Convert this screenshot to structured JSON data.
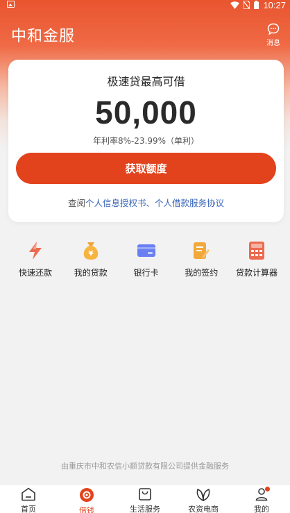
{
  "status_bar": {
    "time": "10:27"
  },
  "header": {
    "title": "中和金服",
    "message_label": "消息"
  },
  "loan_card": {
    "heading": "极速贷最高可借",
    "amount": "50,000",
    "rate": "年利率8%-23.99%（单利）",
    "button_label": "获取额度",
    "agreement_prefix": "查阅",
    "agreement_link": "个人信息授权书、个人借款服务协议"
  },
  "quick_actions": [
    {
      "label": "快速还款",
      "icon": "lightning-icon"
    },
    {
      "label": "我的贷款",
      "icon": "money-bag-icon"
    },
    {
      "label": "银行卡",
      "icon": "bank-card-icon"
    },
    {
      "label": "我的签约",
      "icon": "contract-icon"
    },
    {
      "label": "贷款计算器",
      "icon": "calculator-icon"
    }
  ],
  "footer_note": "由重庆市中和农信小额贷款有限公司提供金融服务",
  "tabbar": [
    {
      "label": "首页",
      "icon": "home-icon",
      "active": false
    },
    {
      "label": "借钱",
      "icon": "borrow-icon",
      "active": true
    },
    {
      "label": "生活服务",
      "icon": "shopping-bag-icon",
      "active": false
    },
    {
      "label": "农资电商",
      "icon": "leaf-icon",
      "active": false
    },
    {
      "label": "我的",
      "icon": "user-icon",
      "active": false
    }
  ],
  "colors": {
    "accent": "#e2431c",
    "link": "#3a66b8",
    "header_gradient_top": "#e8552f"
  }
}
